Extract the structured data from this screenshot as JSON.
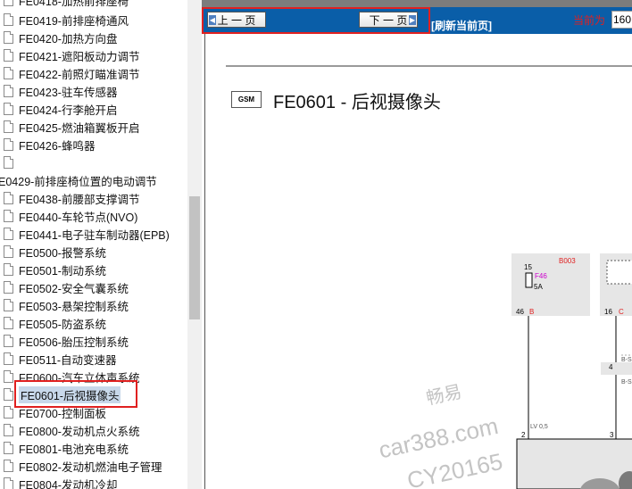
{
  "tree": {
    "items": [
      {
        "label": "FE0419-前排座椅通风",
        "indent": false
      },
      {
        "label": "FE0420-加热方向盘",
        "indent": false
      },
      {
        "label": "FE0421-遮阳板动力调节",
        "indent": false
      },
      {
        "label": "FE0422-前照灯瞄准调节",
        "indent": false
      },
      {
        "label": "FE0423-驻车传感器",
        "indent": false
      },
      {
        "label": "FE0424-行李舱开启",
        "indent": false
      },
      {
        "label": "FE0425-燃油箱翼板开启",
        "indent": false
      },
      {
        "label": "FE0426-蜂鸣器",
        "indent": false
      },
      {
        "label": "",
        "indent": false
      },
      {
        "label": "E0429-前排座椅位置的电动调节",
        "indent": true
      },
      {
        "label": "FE0438-前腰部支撑调节",
        "indent": false
      },
      {
        "label": "FE0440-车轮节点(NVO)",
        "indent": false
      },
      {
        "label": "FE0441-电子驻车制动器(EPB)",
        "indent": false
      },
      {
        "label": "FE0500-报警系统",
        "indent": false
      },
      {
        "label": "FE0501-制动系统",
        "indent": false
      },
      {
        "label": "FE0502-安全气囊系统",
        "indent": false
      },
      {
        "label": "FE0503-悬架控制系统",
        "indent": false
      },
      {
        "label": "FE0505-防盗系统",
        "indent": false
      },
      {
        "label": "FE0506-胎压控制系统",
        "indent": false
      },
      {
        "label": "FE0511-自动变速器",
        "indent": false
      },
      {
        "label": "FE0600-汽车立体声系统",
        "indent": false
      },
      {
        "label": "FE0601-后视摄像头",
        "indent": false,
        "selected": true
      },
      {
        "label": "FE0700-控制面板",
        "indent": false
      },
      {
        "label": "FE0800-发动机点火系统",
        "indent": false
      },
      {
        "label": "FE0801-电池充电系统",
        "indent": false
      },
      {
        "label": "FE0802-发动机燃油电子管理",
        "indent": false
      },
      {
        "label": "FE0804-发动机冷却",
        "indent": false
      }
    ]
  },
  "toolbar": {
    "prev_label": "上 一 页",
    "next_label": "下 一 页",
    "refresh_label": "[刷新当前页]",
    "current_label": "当前为",
    "current_value": "160"
  },
  "main": {
    "badge": "GSM",
    "title": "FE0601 - 后视摄像头"
  },
  "diagram": {
    "box1_id": "B003",
    "pin_top": "15",
    "fuse_name": "F46",
    "fuse_rating": "5A",
    "pin_bottom_num": "46",
    "pin_bottom_letter": "B",
    "box2_pin_num": "16",
    "box2_pin_letter": "C",
    "wire_label_1": "B-S",
    "wire_label_2": "B-S",
    "splice_num": "4",
    "wire_lv": "LV 0,5",
    "conn_pin_a": "2",
    "conn_pin_b": "3"
  },
  "watermark": {
    "line1": "畅易",
    "line2": "car388.com",
    "line3": "CY20165"
  },
  "colors": {
    "toolbar_bg": "#0a5ea8",
    "highlight_red": "#e02020",
    "selection_bg": "#c8d8ea"
  }
}
